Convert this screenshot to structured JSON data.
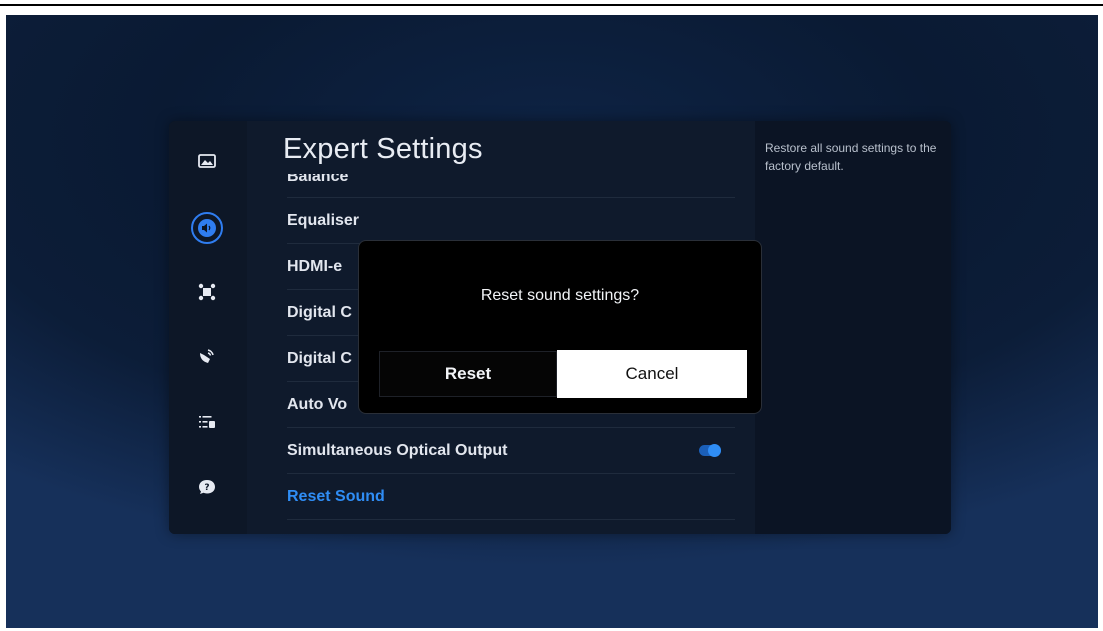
{
  "page": {
    "title": "Expert Settings"
  },
  "sidebar": {
    "items": [
      {
        "icon": "picture-icon",
        "active": false
      },
      {
        "icon": "sound-icon",
        "active": true
      },
      {
        "icon": "connection-icon",
        "active": false
      },
      {
        "icon": "broadcast-icon",
        "active": false
      },
      {
        "icon": "general-icon",
        "active": false
      },
      {
        "icon": "support-icon",
        "active": false
      }
    ]
  },
  "menu": {
    "items": [
      {
        "label": "Balance"
      },
      {
        "label": "Equaliser"
      },
      {
        "label": "HDMI-e"
      },
      {
        "label": "Digital C"
      },
      {
        "label": "Digital C"
      },
      {
        "label": "Auto Vo"
      },
      {
        "label": "Simultaneous Optical Output",
        "toggle": true
      },
      {
        "label": "Reset Sound",
        "selected": true
      }
    ]
  },
  "description": "Restore all sound settings to the factory default.",
  "dialog": {
    "message": "Reset sound settings?",
    "reset_label": "Reset",
    "cancel_label": "Cancel"
  },
  "colors": {
    "accent": "#2f8df5",
    "background": "#0a1a33",
    "panel": "#0f1a2c",
    "dialog": "#000000"
  }
}
